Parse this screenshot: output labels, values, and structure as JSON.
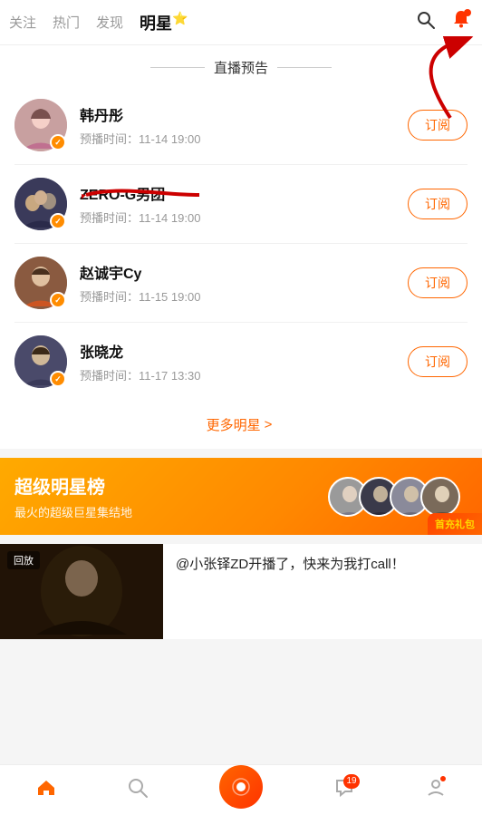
{
  "nav": {
    "tabs": [
      {
        "id": "follow",
        "label": "关注",
        "active": false
      },
      {
        "id": "hot",
        "label": "热门",
        "active": false
      },
      {
        "id": "discover",
        "label": "发现",
        "active": false
      },
      {
        "id": "star",
        "label": "明星",
        "active": true
      }
    ],
    "search_icon": "🔍",
    "bell_icon": "🔔"
  },
  "broadcast_section": {
    "title": "直播预告",
    "stars": [
      {
        "name": "韩丹彤",
        "time": "预播时间：11-14 19:00",
        "btn": "订阅",
        "avatar_type": "1"
      },
      {
        "name": "ZERO-G男团",
        "time": "预播时间：11-14 19:00",
        "btn": "订阅",
        "avatar_type": "2"
      },
      {
        "name": "赵诚宇Cy",
        "time": "预播时间：11-15 19:00",
        "btn": "订阅",
        "avatar_type": "3"
      },
      {
        "name": "张晓龙",
        "time": "预播时间：11-17 13:30",
        "btn": "订阅",
        "avatar_type": "4"
      }
    ],
    "more_label": "更多明星",
    "more_arrow": ">"
  },
  "super_banner": {
    "title": "超级明星榜",
    "subtitle": "最火的超级巨星集结地",
    "gift_label": "首充礼包"
  },
  "video_card": {
    "replay_label": "回放",
    "title": "@小张铎ZD开播了，快来为我打call！"
  },
  "bottom_nav": {
    "items": [
      {
        "id": "home",
        "icon": "🏠",
        "label": ""
      },
      {
        "id": "search",
        "icon": "🔍",
        "label": ""
      },
      {
        "id": "live",
        "icon": "📹",
        "label": "",
        "is_live": true
      },
      {
        "id": "messages",
        "icon": "💬",
        "label": "",
        "badge": "19"
      },
      {
        "id": "profile",
        "icon": "👤",
        "label": "",
        "has_dot": true
      }
    ]
  }
}
